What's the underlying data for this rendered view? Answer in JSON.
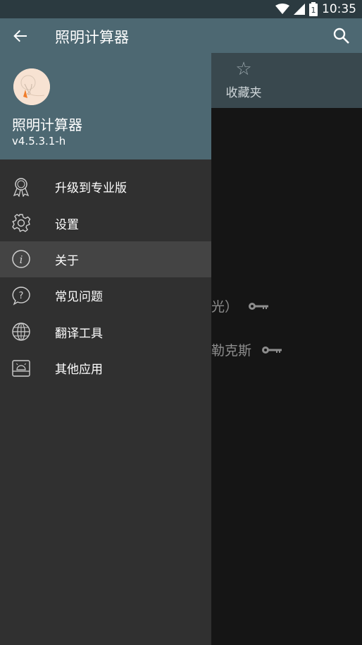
{
  "status_bar": {
    "time": "10:35",
    "battery_label": "1"
  },
  "app_bar": {
    "title": "照明计算器"
  },
  "background": {
    "favorites_tab": {
      "label": "收藏夹",
      "icon": "star-icon"
    },
    "rows": [
      {
        "text": "光）",
        "icon": "key-icon"
      },
      {
        "text": "勒克斯",
        "icon": "key-icon"
      }
    ]
  },
  "drawer": {
    "header": {
      "title": "照明计算器",
      "version": "v4.5.3.1-h"
    },
    "items": [
      {
        "label": "升级到专业版",
        "icon": "award-icon"
      },
      {
        "label": "设置",
        "icon": "gear-icon"
      },
      {
        "label": "关于",
        "icon": "info-icon",
        "active": true
      },
      {
        "label": "常见问题",
        "icon": "question-bubble-icon"
      },
      {
        "label": "翻译工具",
        "icon": "globe-icon"
      },
      {
        "label": "其他应用",
        "icon": "android-icon"
      }
    ]
  },
  "colors": {
    "app_bar": "#4d6872",
    "drawer_bg": "#303030",
    "active_item": "#444444",
    "status_bar": "#2b3a40"
  }
}
